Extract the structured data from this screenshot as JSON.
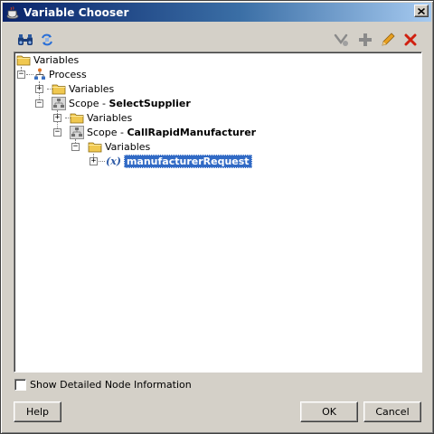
{
  "window": {
    "title": "Variable Chooser",
    "icons": {
      "app": "java-cup-icon",
      "close": "close-icon"
    }
  },
  "toolbar": {
    "left": [
      {
        "icon": "binoculars-icon",
        "name": "find-button"
      },
      {
        "icon": "refresh-icon",
        "name": "refresh-button"
      }
    ],
    "right": [
      {
        "icon": "create-variable-icon",
        "name": "create-button"
      },
      {
        "icon": "plus-icon",
        "name": "add-button"
      },
      {
        "icon": "pencil-icon",
        "name": "edit-button"
      },
      {
        "icon": "delete-x-icon",
        "name": "delete-button"
      }
    ]
  },
  "tree": {
    "nodes": [
      {
        "label": "Variables",
        "icon": "folder-icon",
        "depth": 0
      },
      {
        "label": "Process",
        "icon": "process-icon",
        "depth": 1
      },
      {
        "label": "Variables",
        "icon": "folder-icon",
        "depth": 2
      },
      {
        "label_prefix": "Scope - ",
        "label_bold": "SelectSupplier",
        "icon": "scope-icon",
        "depth": 2
      },
      {
        "label": "Variables",
        "icon": "folder-icon",
        "depth": 3
      },
      {
        "label_prefix": "Scope - ",
        "label_bold": "CallRapidManufacturer",
        "icon": "scope-icon",
        "depth": 3
      },
      {
        "label": "Variables",
        "icon": "folder-icon",
        "depth": 4
      },
      {
        "label": "manufacturerRequest",
        "icon": "variable-icon",
        "icon_text": "(x)",
        "depth": 5,
        "selected": true
      }
    ]
  },
  "options": {
    "show_detailed_label": "Show Detailed Node Information",
    "show_detailed_checked": false
  },
  "buttons": {
    "help": "Help",
    "ok": "OK",
    "cancel": "Cancel"
  }
}
